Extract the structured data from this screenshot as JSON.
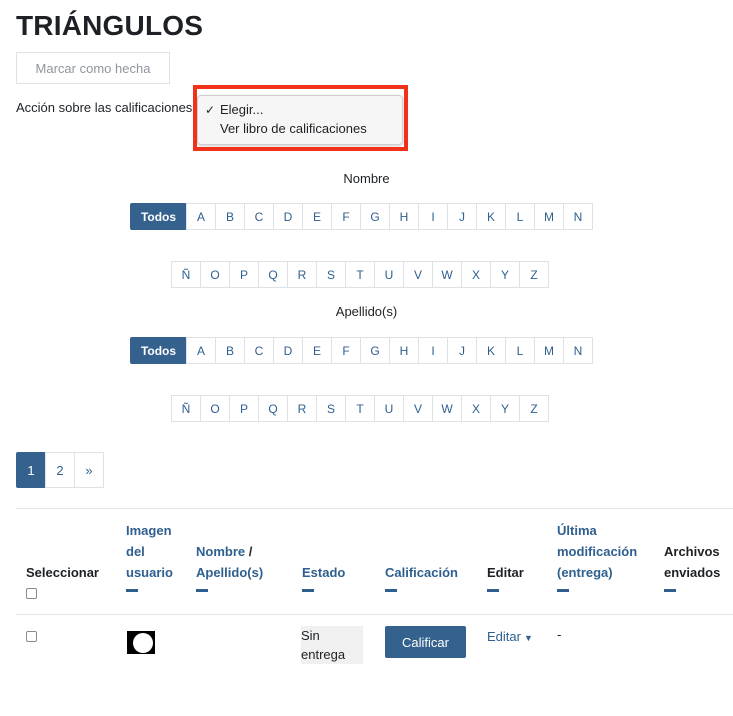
{
  "page": {
    "title": "TRIÁNGULOS",
    "mark_done": "Marcar como hecha",
    "action_label": "Acción sobre las calificaciones"
  },
  "dropdown": {
    "check_glyph": "✓",
    "options": [
      "Elegir...",
      "Ver libro de calificaciones"
    ],
    "selected": "Elegir...",
    "highlight_color": "#f2311b"
  },
  "first_name_filter": {
    "title": "Nombre",
    "all": "Todos",
    "row1": [
      "A",
      "B",
      "C",
      "D",
      "E",
      "F",
      "G",
      "H",
      "I",
      "J",
      "K",
      "L",
      "M",
      "N"
    ],
    "row2": [
      "Ñ",
      "O",
      "P",
      "Q",
      "R",
      "S",
      "T",
      "U",
      "V",
      "W",
      "X",
      "Y",
      "Z"
    ]
  },
  "last_name_filter": {
    "title": "Apellido(s)",
    "all": "Todos",
    "row1": [
      "A",
      "B",
      "C",
      "D",
      "E",
      "F",
      "G",
      "H",
      "I",
      "J",
      "K",
      "L",
      "M",
      "N"
    ],
    "row2": [
      "Ñ",
      "O",
      "P",
      "Q",
      "R",
      "S",
      "T",
      "U",
      "V",
      "W",
      "X",
      "Y",
      "Z"
    ]
  },
  "pagination": {
    "pages": [
      "1",
      "2"
    ],
    "current": "1",
    "next": "»"
  },
  "table": {
    "headers": {
      "select": "Seleccionar",
      "user_image": "Imagen del usuario",
      "name": "Nombre",
      "name_sep": " / ",
      "surname": "Apellido(s)",
      "status": "Estado",
      "grade": "Calificación",
      "edit": "Editar",
      "last_modified": "Última modificación (entrega)",
      "files": "Archivos enviados"
    },
    "rows": [
      {
        "status": "Sin entrega",
        "grade_button": "Calificar",
        "edit_link": "Editar",
        "last_modified": "-"
      }
    ]
  },
  "colors": {
    "primary": "#35618f",
    "link": "#2e5f8f",
    "border": "#dee2e6"
  }
}
